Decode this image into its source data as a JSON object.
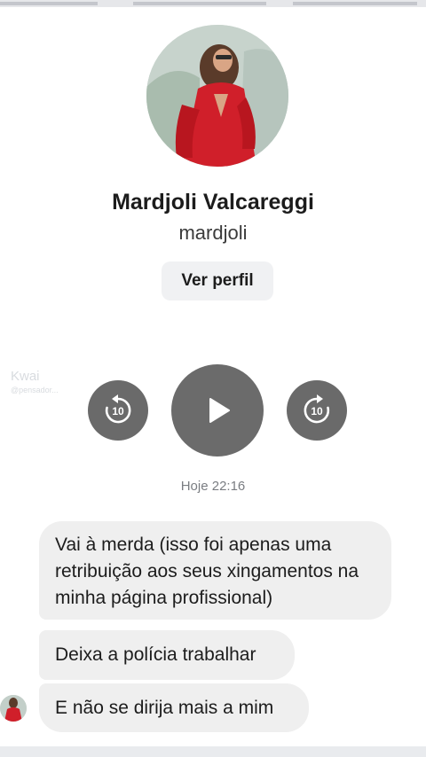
{
  "profile": {
    "name": "Mardjoli Valcareggi",
    "username": "mardjoli",
    "view_profile_label": "Ver perfil"
  },
  "watermark": {
    "brand": "Kwai",
    "handle": "@pensador..."
  },
  "player": {
    "rewind_seconds": "10",
    "forward_seconds": "10"
  },
  "chat": {
    "timestamp": "Hoje 22:16",
    "messages": [
      "Vai à merda (isso foi apenas uma retribuição aos seus xingamentos na minha página profissional)",
      "Deixa a polícia trabalhar",
      "E não se dirija mais a mim"
    ]
  },
  "colors": {
    "bubble_bg": "#efefef",
    "player_button": "#6b6b6b",
    "dress_red": "#d01f2a"
  }
}
